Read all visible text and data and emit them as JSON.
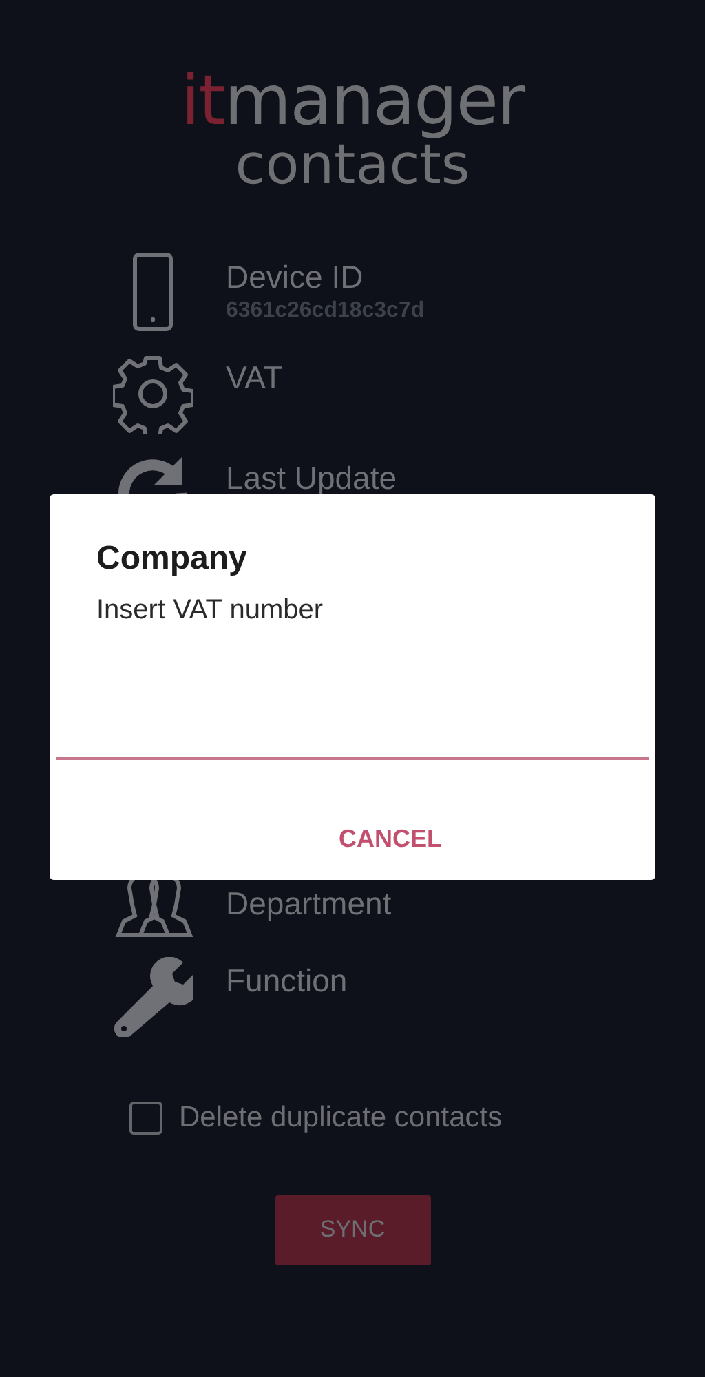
{
  "logo": {
    "prefix": "it",
    "name": "manager",
    "subtitle": "contacts"
  },
  "settings": [
    {
      "kind": "device",
      "label": "Device ID",
      "value": "6361c26cd18c3c7d"
    },
    {
      "kind": "vat",
      "label": "VAT"
    },
    {
      "kind": "update",
      "label": "Last Update"
    },
    {
      "kind": "department",
      "label": "Department"
    },
    {
      "kind": "function",
      "label": "Function"
    }
  ],
  "checkbox": {
    "label": "Delete duplicate contacts",
    "checked": false
  },
  "sync_button": "SYNC",
  "dialog": {
    "title": "Company",
    "message": "Insert VAT number",
    "buttons": [
      "CANCEL"
    ]
  }
}
